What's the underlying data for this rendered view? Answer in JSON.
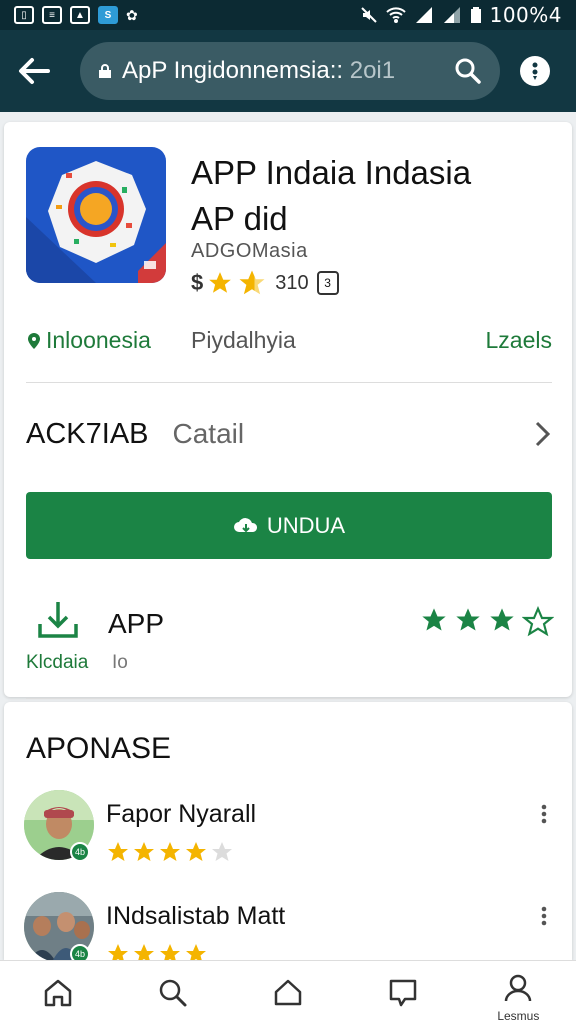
{
  "status_bar": {
    "battery_text": "100%4"
  },
  "toolbar": {
    "search_text": "ApP Ingidonnemsia::",
    "search_suffix": "2oi1"
  },
  "app": {
    "title_line1": "APP Indaia Indasia",
    "title_line2": "AP did",
    "developer": "ADGOMasia",
    "rating_prefix": "$",
    "rating_count": "310",
    "country": "Inloonesia",
    "category": "Piydalhyia",
    "size_label": "Lzaels",
    "rating_stars": 2.5
  },
  "detail": {
    "main": "ACK7IAB",
    "sub": "Catail"
  },
  "install": {
    "label": "UNDUA"
  },
  "downloads": {
    "app_label": "APP",
    "label": "Klcdaia",
    "sub": "Io",
    "stars_filled": 3,
    "stars_total": 4
  },
  "reviews": {
    "title": "APONASE",
    "items": [
      {
        "name": "Fapor Nyarall",
        "stars": 4,
        "badge": "4b"
      },
      {
        "name": "INdsalistab Matt",
        "stars": 4,
        "badge": "4b"
      }
    ]
  },
  "bottom_nav": {
    "profile_label": "Lesmus"
  },
  "colors": {
    "header": "#123742",
    "statusbar": "#0c2a33",
    "accent_green": "#1b8445",
    "star_gold": "#f4b400"
  }
}
